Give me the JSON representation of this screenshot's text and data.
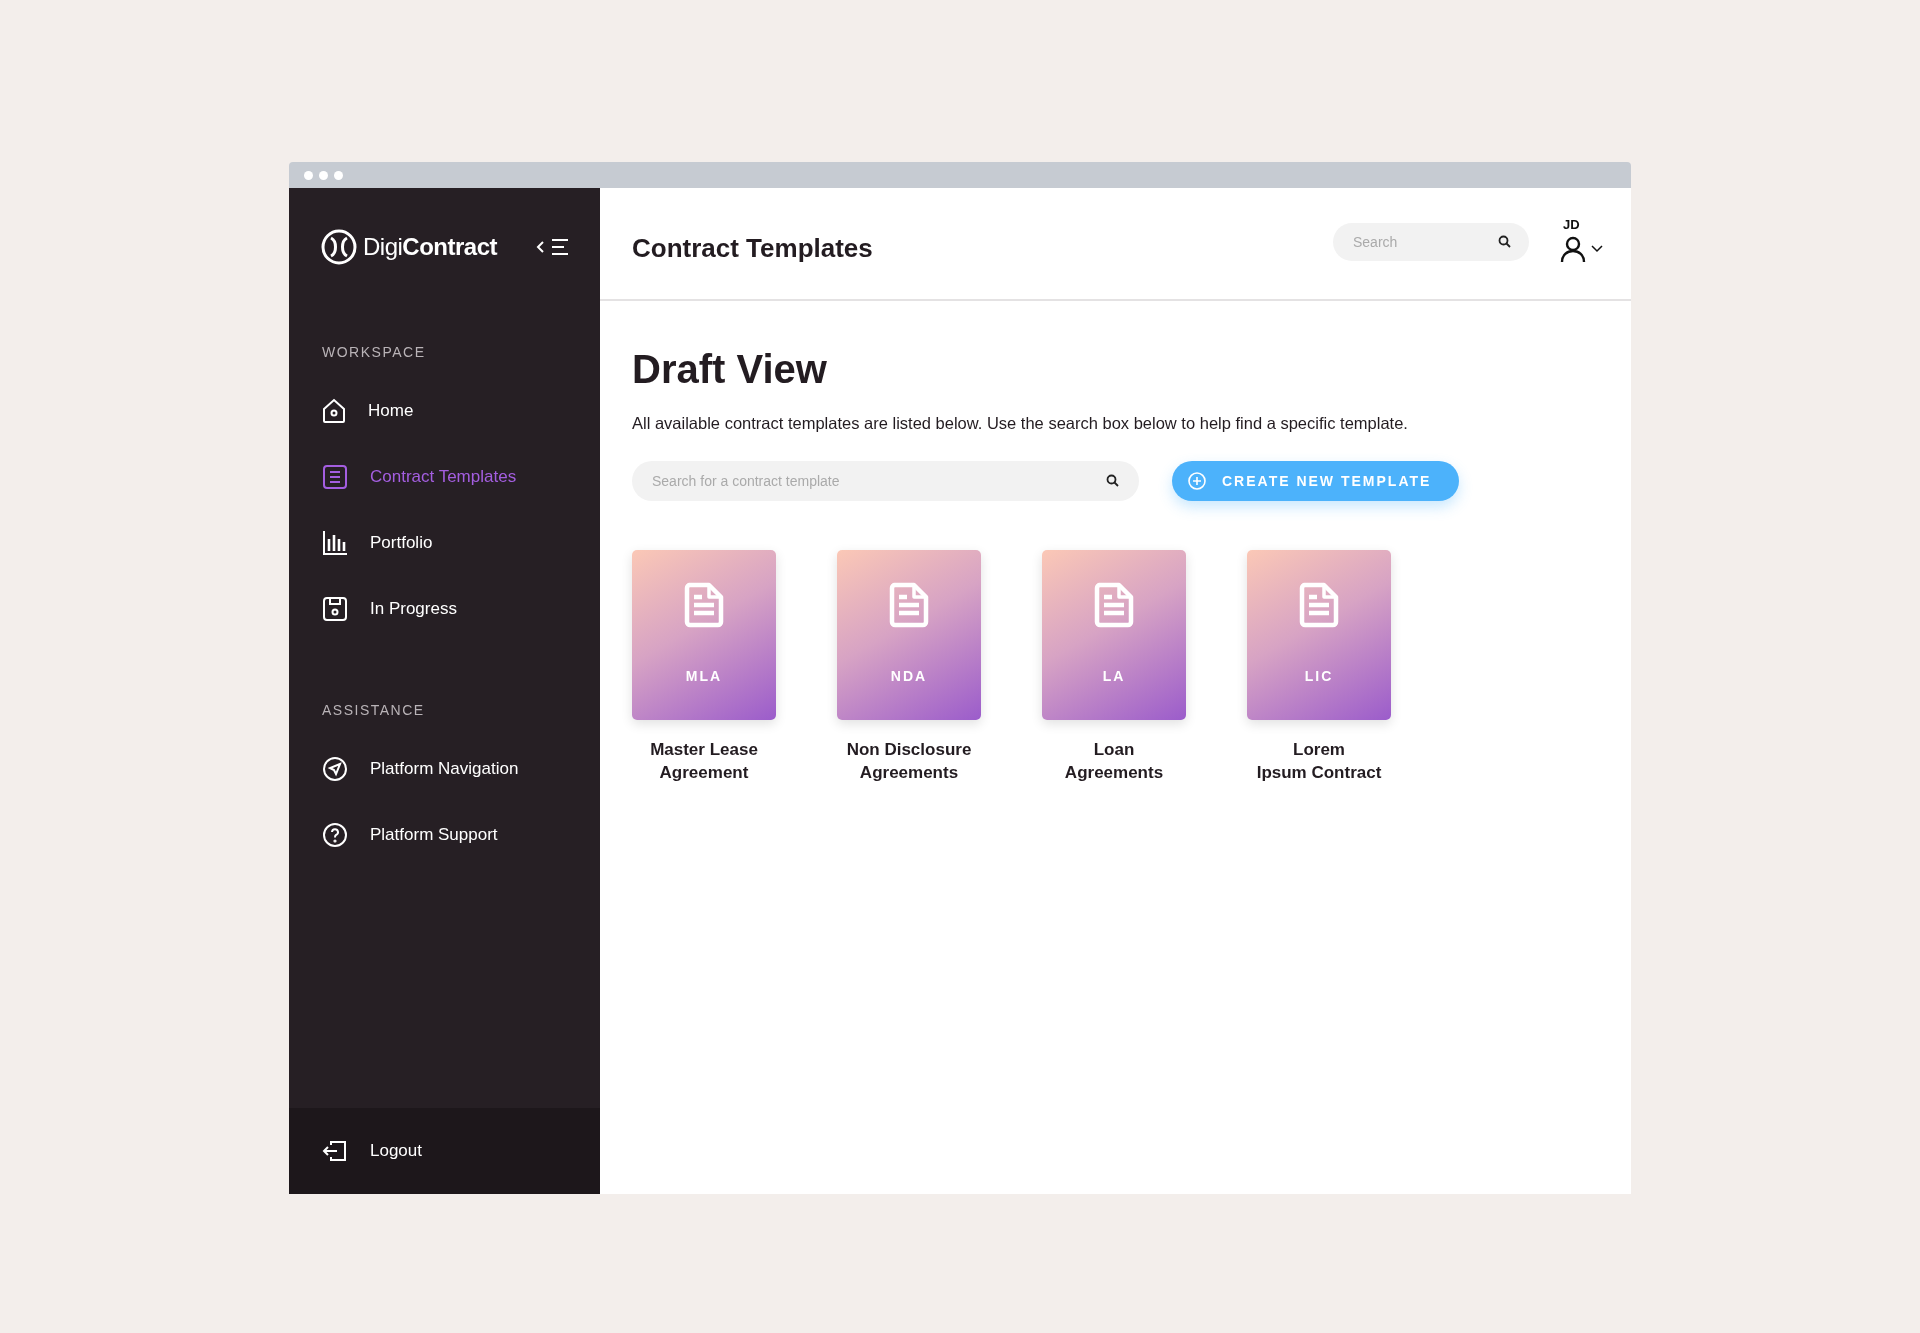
{
  "brand": {
    "logo_text": "Digi**Contract**"
  },
  "sidebar": {
    "sections": [
      {
        "heading": "WORKSPACE",
        "items": [
          {
            "label": "Home",
            "selected": false
          },
          {
            "label": "Contract Templates",
            "selected": true
          },
          {
            "label": "Portfolio",
            "selected": false
          },
          {
            "label": "In Progress",
            "selected": false
          }
        ]
      },
      {
        "heading": "ASSISTANCE",
        "items": [
          {
            "label": "Platform Navigation",
            "selected": false
          },
          {
            "label": "Platform Support",
            "selected": false
          }
        ]
      }
    ],
    "logout": "Logout"
  },
  "header": {
    "title": "Contract Templates",
    "search": {
      "placeholder": "Search"
    },
    "user": "JD"
  },
  "content": {
    "heading": "Draft View",
    "description": "All available contract templates are listed below. Use the search box below to help find a specific template.",
    "search": {
      "placeholder": "Search for a contract template"
    },
    "create_button": "CREATE NEW TEMPLATE",
    "templates": [
      {
        "code": "MLA",
        "name": "Master Lease\nAgreement"
      },
      {
        "code": "NDA",
        "name": "Non Disclosure\nAgreements"
      },
      {
        "code": "LA",
        "name": "Loan\nAgreements"
      },
      {
        "code": "LIC",
        "name": "Lorem\nIpsum Contract"
      }
    ]
  }
}
